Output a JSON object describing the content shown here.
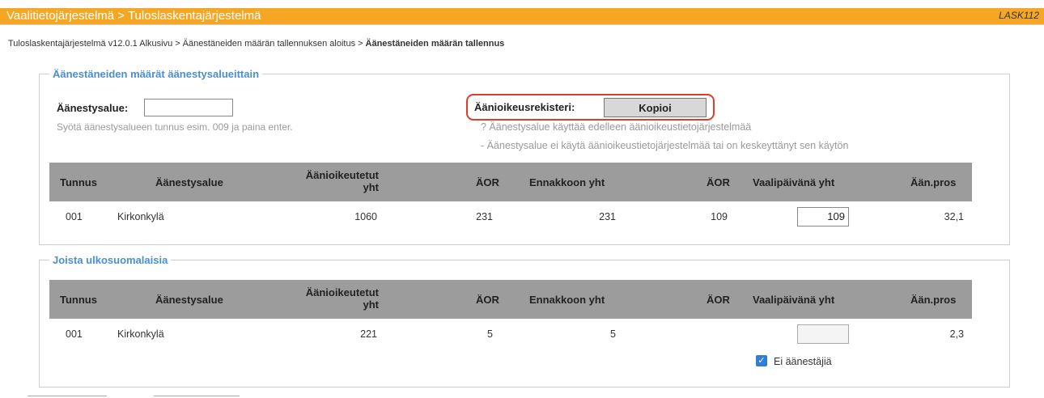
{
  "header": {
    "title": "Vaalitietojärjestelmä > Tuloslaskentajärjestelmä",
    "code": "LASK112",
    "accent_color": "#f5a623"
  },
  "breadcrumb": {
    "items": [
      "Tuloslaskentajärjestelmä v12.0.1 Alkusivu",
      "Äänestäneiden määrän tallennuksen aloitus",
      "Äänestäneiden määrän tallennus"
    ],
    "separator": ">"
  },
  "section1": {
    "legend": "Äänestäneiden määrät äänestysalueittain",
    "area_label": "Äänestysalue:",
    "area_value": "",
    "hint": "Syötä äänestysalueen tunnus esim. 009 ja paina enter.",
    "register_label": "Äänioikeusrekisteri:",
    "copy_button": "Kopioi",
    "note1": "? Äänestysalue käyttää edelleen äänioikeustietojärjestelmää",
    "note2": "- Äänestysalue ei käytä äänioikeustietojärjestelmää tai on keskeyttänyt sen käytön",
    "highlight_color": "#e23b2a"
  },
  "columns": {
    "tunnus": "Tunnus",
    "alue": "Äänestysalue",
    "oikeutetut_line1": "Äänioikeutetut",
    "oikeutetut_line2": "yht",
    "aor": "ÄOR",
    "ennakko": "Ennakkoon yht",
    "aor2": "ÄOR",
    "vaalipaiva": "Vaalipäivänä yht",
    "pros": "Ään.pros"
  },
  "table1": {
    "row": {
      "tunnus": "001",
      "alue": "Kirkonkylä",
      "oikeutetut": "1060",
      "aor": "231",
      "ennakko": "231",
      "aor2": "109",
      "vaalipaiva": "109",
      "pros": "32,1"
    }
  },
  "section2": {
    "legend": "Joista ulkosuomalaisia",
    "row": {
      "tunnus": "001",
      "alue": "Kirkonkylä",
      "oikeutetut": "221",
      "aor": "5",
      "ennakko": "5",
      "aor2": "",
      "vaalipaiva": "",
      "pros": "2,3"
    },
    "checkbox_label": "Ei äänestäjiä",
    "checkbox_checked": true
  }
}
